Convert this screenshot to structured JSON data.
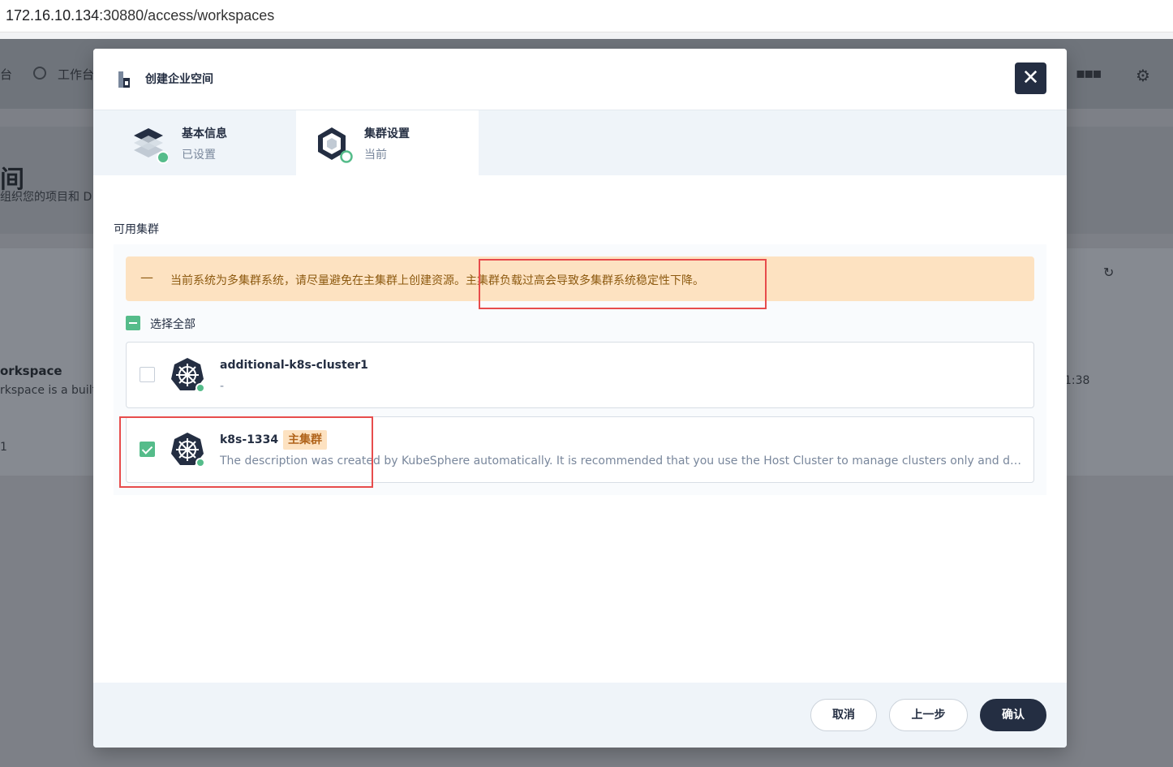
{
  "browser": {
    "url_host": "172.16.10.134",
    "url_path": ":30880/access/workspaces"
  },
  "background": {
    "nav_left_fragment": "台",
    "nav_workbench": "工作台",
    "hero_title_fragment": "间",
    "hero_desc_fragment": "组织您的项目和 D",
    "ws_name_fragment": "orkspace",
    "ws_desc_fragment": "rkspace is a built-",
    "ws_time_fragment": "1:38",
    "ws_count_fragment": "1"
  },
  "modal": {
    "title": "创建企业空间",
    "close_glyph": "✕",
    "steps": [
      {
        "title": "基本信息",
        "status": "已设置",
        "icon": "layers-icon"
      },
      {
        "title": "集群设置",
        "status": "当前",
        "icon": "cube-icon"
      }
    ],
    "section_label": "可用集群",
    "warning": {
      "icon": "minus-icon",
      "text": "当前系统为多集群系统，请尽量避免在主集群上创建资源。主集群负载过高会导致多集群系统稳定性下降。"
    },
    "select_all_label": "选择全部",
    "clusters": [
      {
        "name": "additional-k8s-cluster1",
        "description": "-",
        "tag": "",
        "checked": false,
        "icon": "kubernetes-icon"
      },
      {
        "name": "k8s-1334",
        "description": "The description was created by KubeSphere automatically. It is recommended that you use the Host Cluster to manage clusters only and deploy workloads on Member Clusters.",
        "tag": "主集群",
        "checked": true,
        "icon": "kubernetes-icon"
      }
    ],
    "footer": {
      "cancel_label": "取消",
      "prev_label": "上一步",
      "confirm_label": "确认"
    }
  },
  "colors": {
    "primary_dark": "#242e42",
    "success_green": "#55bc8a",
    "warning_bg": "#fde2c1",
    "warning_text": "#8d5a10",
    "annotation_red": "#e74c4c"
  }
}
